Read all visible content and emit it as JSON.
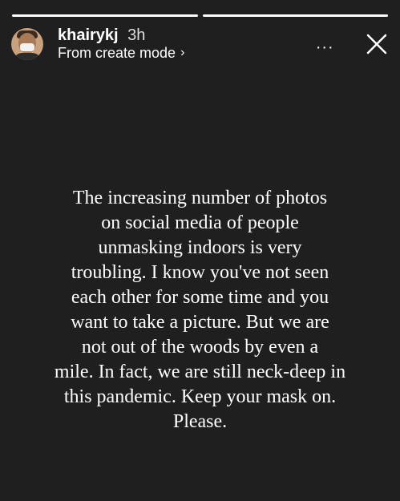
{
  "story": {
    "progress": [
      1.0,
      1.0
    ],
    "user": {
      "username": "khairykj",
      "time": "3h",
      "subtitle": "From create mode",
      "avatar_icon": "profile-avatar"
    },
    "actions": {
      "more_icon": "more-options-icon",
      "more_glyph": "...",
      "close_icon": "close-icon"
    },
    "text_lines": [
      "The increasing number of photos",
      "on social media of people",
      "unmasking indoors is very",
      "troubling. I know you've not seen",
      "each other for some time and you",
      "want to take a picture. But we are",
      "not out of the woods by even a",
      "mile. In fact, we are still neck-deep in",
      "this pandemic. Keep your mask on.",
      "Please."
    ]
  },
  "colors": {
    "background": "#1f1f1f",
    "text": "#ffffff"
  }
}
